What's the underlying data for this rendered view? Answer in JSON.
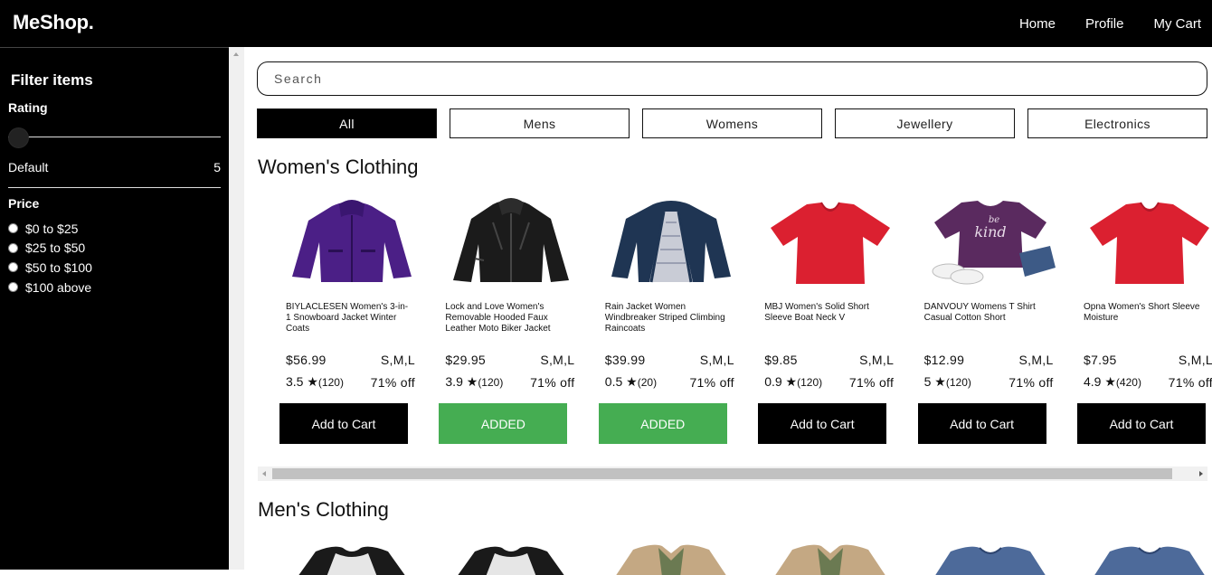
{
  "header": {
    "logo": "MeShop.",
    "nav": [
      "Home",
      "Profile",
      "My Cart"
    ]
  },
  "sidebar": {
    "title": "Filter items",
    "rating_label": "Rating",
    "rating_value": 0,
    "default_label": "Default",
    "default_value": "5",
    "price_label": "Price",
    "price_options": [
      "$0 to $25",
      "$25 to $50",
      "$50 to $100",
      "$100 above"
    ]
  },
  "search": {
    "placeholder": "Search"
  },
  "tabs": [
    "All",
    "Mens",
    "Womens",
    "Jewellery",
    "Electronics"
  ],
  "active_tab": "All",
  "sections": [
    {
      "title": "Women's Clothing",
      "products": [
        {
          "image": "purple-jacket",
          "name": "BIYLACLESEN Women's 3-in-1 Snowboard Jacket Winter Coats",
          "price": "$56.99",
          "sizes": "S,M,L",
          "rating": "3.5",
          "count": "(120)",
          "discount": "71% off",
          "button": "Add to Cart",
          "added": false
        },
        {
          "image": "black-leather-jacket",
          "name": "Lock and Love Women's Removable Hooded Faux Leather Moto Biker Jacket",
          "price": "$29.95",
          "sizes": "S,M,L",
          "rating": "3.9",
          "count": "(120)",
          "discount": "71% off",
          "button": "ADDED",
          "added": true
        },
        {
          "image": "navy-rain-jacket",
          "name": "Rain Jacket Women Windbreaker Striped Climbing Raincoats",
          "price": "$39.99",
          "sizes": "S,M,L",
          "rating": "0.5",
          "count": "(20)",
          "discount": "71% off",
          "button": "ADDED",
          "added": true
        },
        {
          "image": "red-tshirt",
          "name": "MBJ Women's Solid Short Sleeve Boat Neck V",
          "price": "$9.85",
          "sizes": "S,M,L",
          "rating": "0.9",
          "count": "(120)",
          "discount": "71% off",
          "button": "Add to Cart",
          "added": false
        },
        {
          "image": "purple-be-kind-tshirt",
          "name": "DANVOUY Womens T Shirt Casual Cotton Short",
          "price": "$12.99",
          "sizes": "S,M,L",
          "rating": "5",
          "count": "(120)",
          "discount": "71% off",
          "button": "Add to Cart",
          "added": false
        },
        {
          "image": "red-tshirt",
          "name": "Opna Women's Short Sleeve Moisture",
          "price": "$7.95",
          "sizes": "S,M,L",
          "rating": "4.9",
          "count": "(420)",
          "discount": "71% off",
          "button": "Add to Cart",
          "added": false
        }
      ]
    },
    {
      "title": "Men's Clothing",
      "products": [
        {
          "image": "raglan-tshirt"
        },
        {
          "image": "raglan-tshirt"
        },
        {
          "image": "khaki-jacket"
        },
        {
          "image": "khaki-jacket"
        },
        {
          "image": "blue-longsleeve"
        },
        {
          "image": "blue-longsleeve"
        }
      ]
    }
  ],
  "colors": {
    "added": "#45ad52",
    "primary": "#000000"
  }
}
